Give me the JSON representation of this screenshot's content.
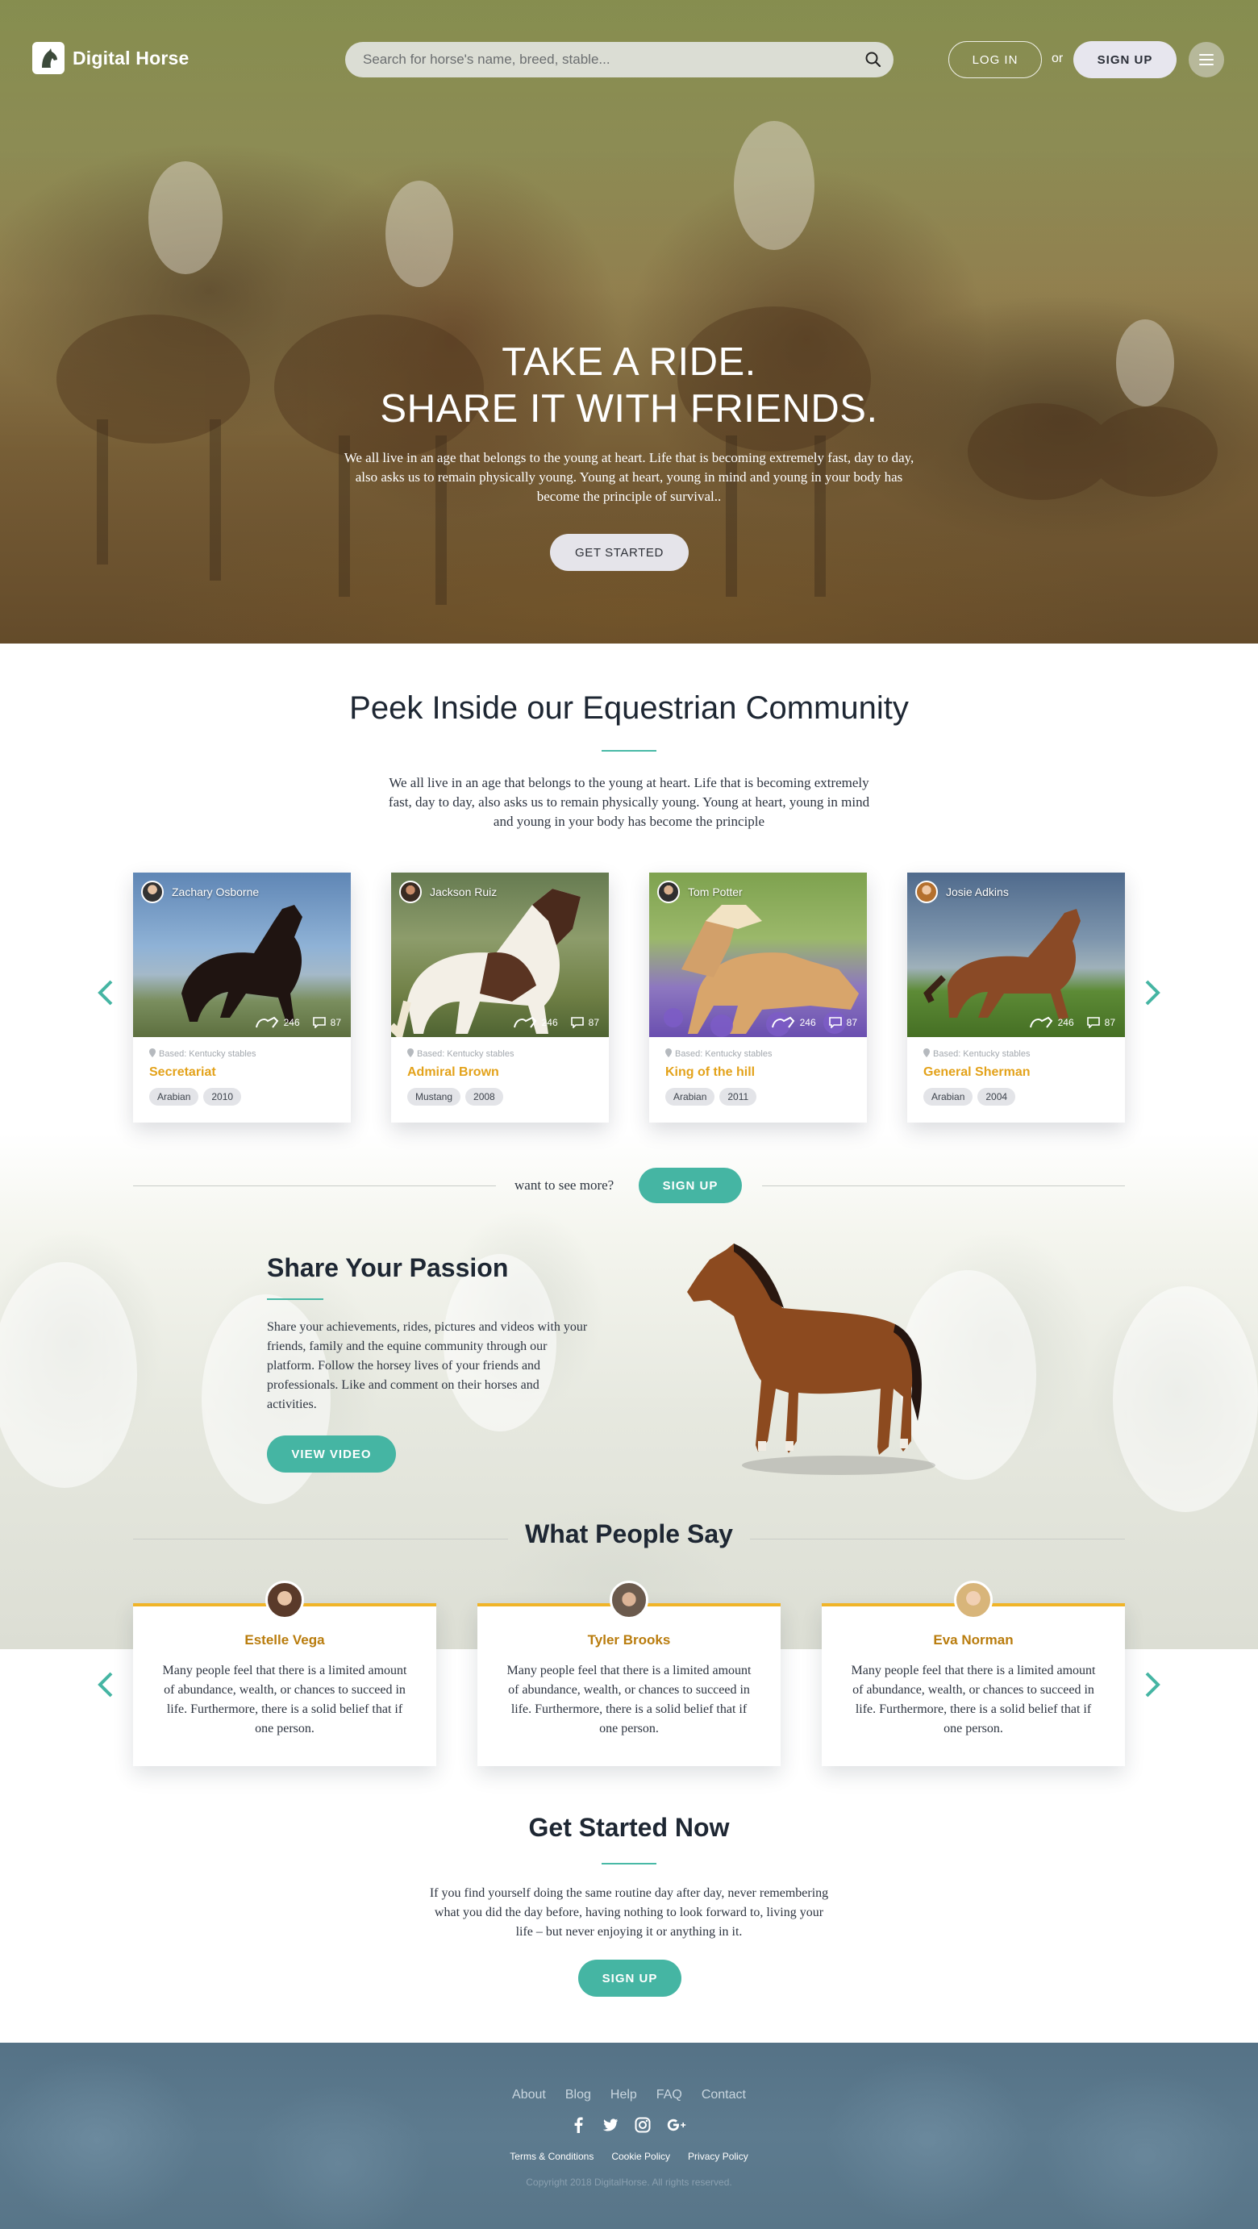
{
  "header": {
    "brand": "Digital Horse",
    "search_placeholder": "Search for horse's name, breed, stable...",
    "login_label": "LOG IN",
    "or_label": "or",
    "signup_label": "SIGN UP"
  },
  "hero": {
    "title_line1": "TAKE A RIDE.",
    "title_line2": "SHARE IT WITH FRIENDS.",
    "text": "We all live in an age that belongs to the young at heart. Life that is becoming extremely fast, day to day, also asks us to remain physically young. Young at heart, young in mind and young in your body has become the principle of survival..",
    "cta_label": "GET STARTED"
  },
  "community": {
    "title": "Peek Inside our Equestrian Community",
    "text": "We all live in an age that belongs to the young at heart. Life that is becoming extremely fast, day to day, also asks us to remain physically young. Young at heart, young in mind and young in your body has become the principle",
    "cards": [
      {
        "owner": "Zachary Osborne",
        "views": "246",
        "comments": "87",
        "based": "Based: Kentucky stables",
        "horse": "Secretariat",
        "breed": "Arabian",
        "year": "2010"
      },
      {
        "owner": "Jackson Ruiz",
        "views": "246",
        "comments": "87",
        "based": "Based: Kentucky stables",
        "horse": "Admiral Brown",
        "breed": "Mustang",
        "year": "2008"
      },
      {
        "owner": "Tom Potter",
        "views": "246",
        "comments": "87",
        "based": "Based: Kentucky stables",
        "horse": "King of the hill",
        "breed": "Arabian",
        "year": "2011"
      },
      {
        "owner": "Josie Adkins",
        "views": "246",
        "comments": "87",
        "based": "Based: Kentucky stables",
        "horse": "General Sherman",
        "breed": "Arabian",
        "year": "2004"
      }
    ],
    "see_more_label": "want to see more?",
    "signup_label": "SIGN UP"
  },
  "passion": {
    "title": "Share Your Passion",
    "text": "Share your achievements, rides, pictures and videos with your friends, family and the equine community through our platform. Follow the horsey lives of your friends and professionals. Like and comment on their horses and activities.",
    "video_label": "VIEW VIDEO"
  },
  "testimonials": {
    "title": "What People Say",
    "items": [
      {
        "name": "Estelle Vega",
        "text": "Many people feel that there is a limited amount of abundance, wealth, or chances to succeed in life. Furthermore, there is a solid belief that if one person."
      },
      {
        "name": "Tyler Brooks",
        "text": "Many people feel that there is a limited amount of abundance, wealth, or chances to succeed in life. Furthermore, there is a solid belief that if one person."
      },
      {
        "name": "Eva Norman",
        "text": "Many people feel that there is a limited amount of abundance, wealth, or chances to succeed in life. Furthermore, there is a solid belief that if one person."
      }
    ]
  },
  "get_started": {
    "title": "Get Started Now",
    "text": "If you find yourself doing the same routine day after day, never remembering what you did the day before, having nothing to look forward to, living your life – but never enjoying it or anything in it.",
    "signup_label": "SIGN UP"
  },
  "footer": {
    "nav": [
      "About",
      "Blog",
      "Help",
      "FAQ",
      "Contact"
    ],
    "social_icons": [
      "facebook-icon",
      "twitter-icon",
      "instagram-icon",
      "google-plus-icon"
    ],
    "legal": [
      "Terms & Conditions",
      "Cookie Policy",
      "Privacy Policy"
    ],
    "copyright": "Copyright 2018 DigitalHorse. All rights reserved."
  },
  "colors": {
    "accent_teal": "#45b5a3",
    "accent_gold": "#e3a21a",
    "review_name": "#b97c0d",
    "footer_bg": "#5a788c"
  }
}
